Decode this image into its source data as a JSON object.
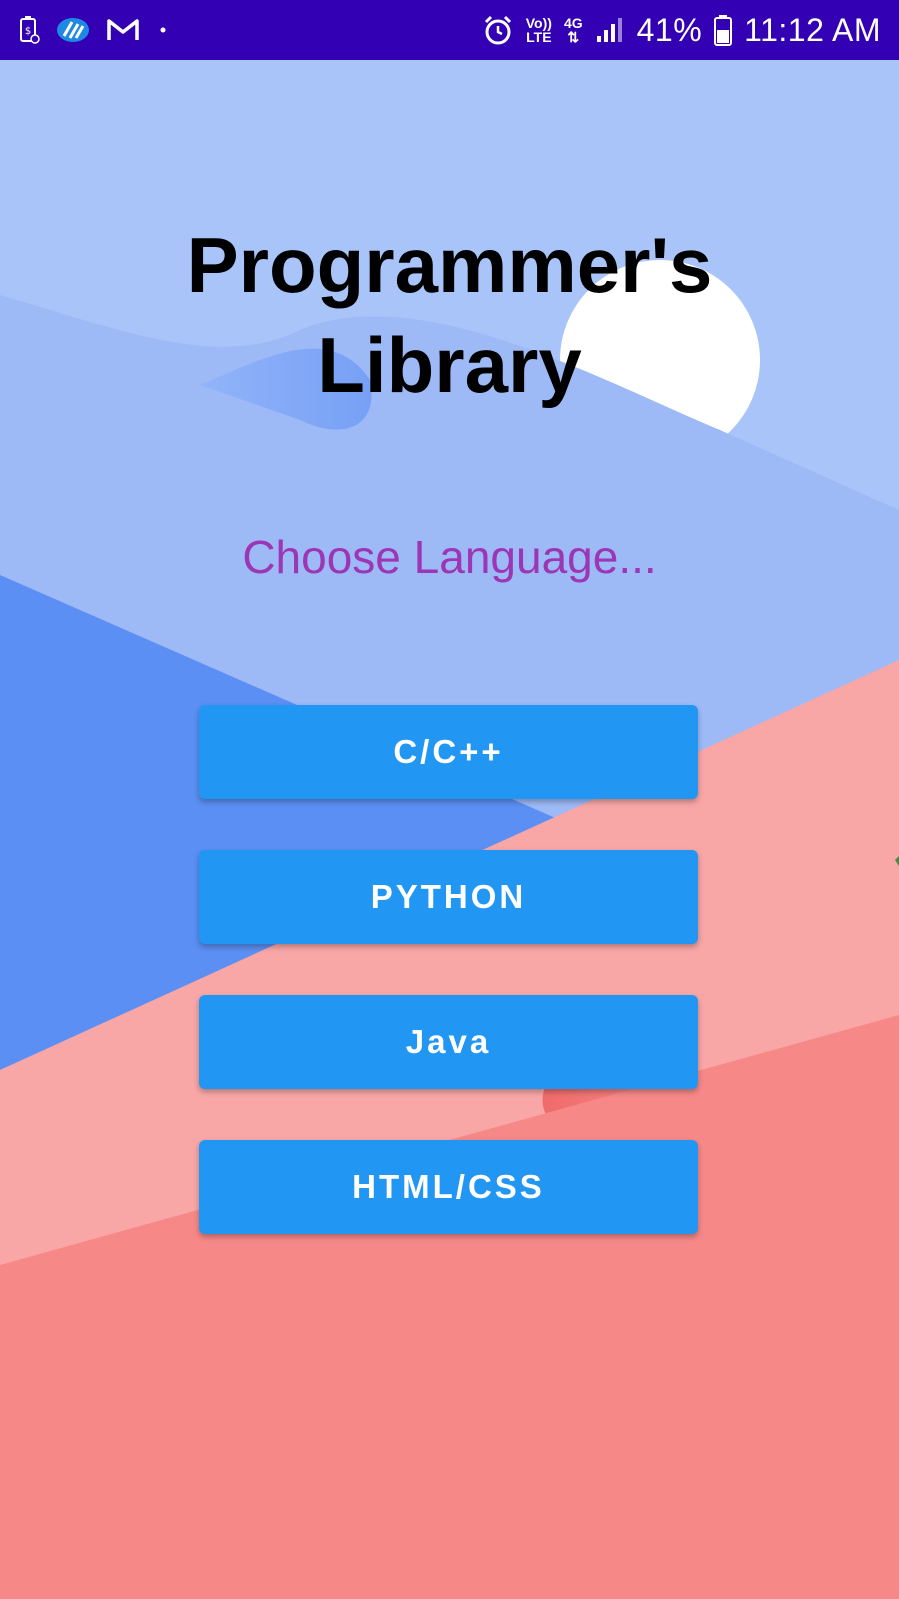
{
  "status_bar": {
    "left_icons": [
      "battery-saver-icon",
      "app-icon",
      "gmail-icon",
      "notification-dot-icon"
    ],
    "alarm_icon": "alarm-icon",
    "volte_top": "Vo))",
    "volte_bottom": "LTE",
    "network_type": "4G",
    "signal_icon": "signal-icon",
    "battery_percent": "41%",
    "battery_icon": "battery-icon",
    "time": "11:12 AM",
    "color": "#3300b3"
  },
  "app": {
    "title_line1": "Programmer's",
    "title_line2": "Library",
    "subtitle": "Choose Language...",
    "subtitle_color": "#9c36b5",
    "buttons": [
      {
        "label": "C/C++"
      },
      {
        "label": "PYTHON"
      },
      {
        "label": "Java"
      },
      {
        "label": "HTML/CSS"
      }
    ],
    "button_color": "#2196f3"
  }
}
